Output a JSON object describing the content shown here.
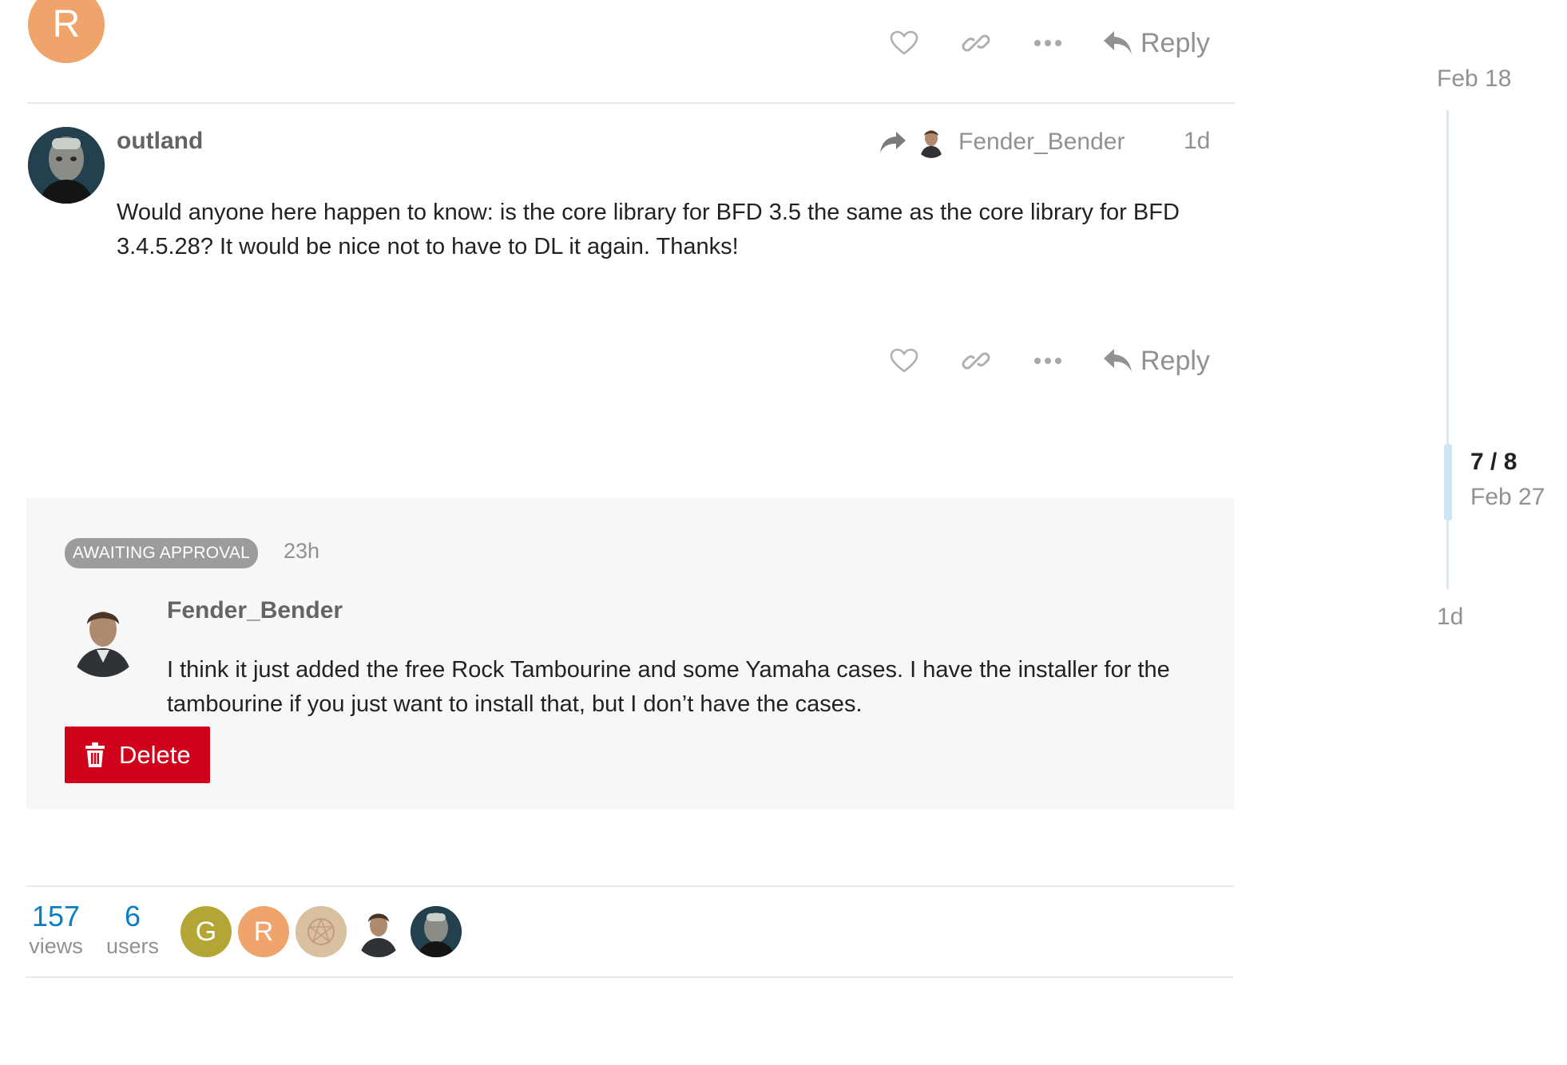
{
  "previous_post": {
    "avatar_letter": "R",
    "avatar_color": "#eea46b",
    "reply_label": "Reply"
  },
  "post": {
    "username": "outland",
    "reply_to_user": "Fender_Bender",
    "age": "1d",
    "body": "Would anyone here happen to know: is the core library for BFD 3.5 the same as the core library for BFD 3.4.5.28? It would be nice not to have to DL it again. Thanks!",
    "reply_label": "Reply"
  },
  "pending_post": {
    "badge": "AWAITING APPROVAL",
    "age": "23h",
    "username": "Fender_Bender",
    "body": "I think it just added the free Rock Tambourine and some Yamaha cases. I have the installer for the tambourine if you just want to install that, but I don’t have the cases.",
    "delete_label": "Delete",
    "delete_color": "#d0021b"
  },
  "topic_map": {
    "views_count": "157",
    "views_label": "views",
    "users_count": "6",
    "users_label": "users",
    "participants": [
      {
        "letter": "G",
        "color": "#b3a636"
      },
      {
        "letter": "R",
        "color": "#eea46b"
      },
      {
        "letter": "",
        "color": "#d9c09e"
      },
      {
        "letter": "",
        "color": "#ffffff"
      },
      {
        "letter": "",
        "color": "#1e3a4a"
      }
    ]
  },
  "timeline": {
    "start_date": "Feb 18",
    "position": "7 / 8",
    "current_date": "Feb 27",
    "end_date": "1d",
    "track_color": "#d6ebf7",
    "handle_color": "#cce6f5"
  },
  "colors": {
    "accent": "#0a7ec1",
    "muted": "#919191",
    "badge": "#9c9c9c"
  }
}
